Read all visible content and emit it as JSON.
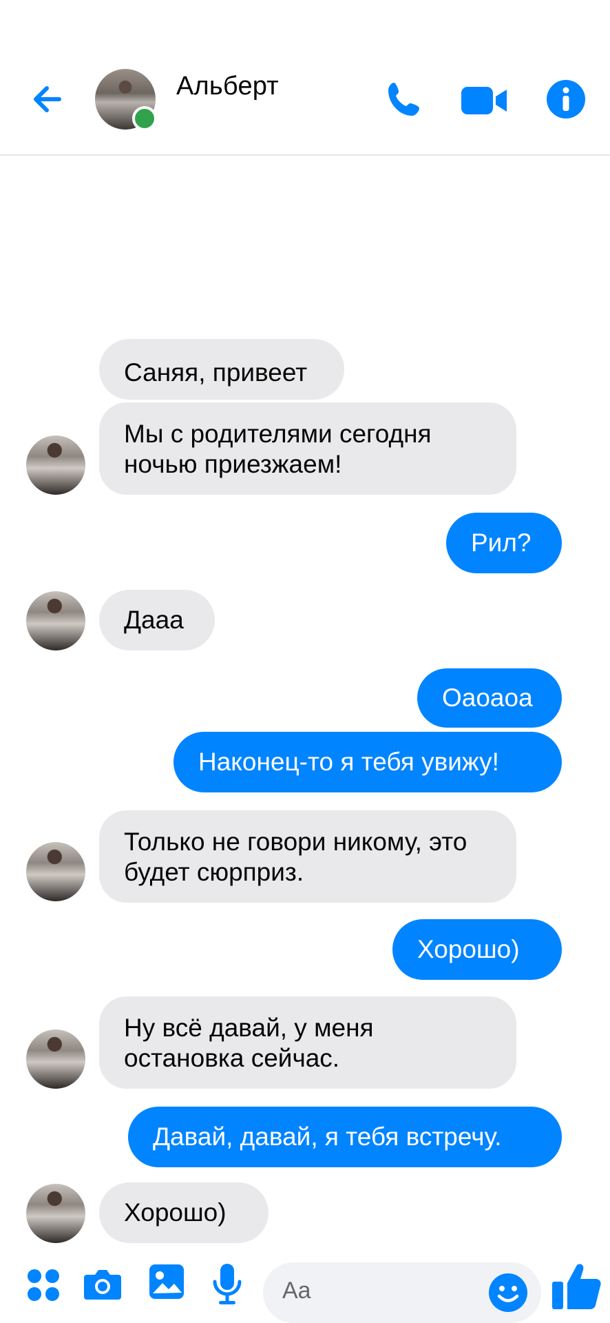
{
  "header": {
    "contact_name": "Альберт",
    "online": true
  },
  "messages": [
    {
      "dir": "in",
      "text": "Саняя, привеет"
    },
    {
      "dir": "in",
      "text": "Мы с родителями сегодня ночью приезжаем!"
    },
    {
      "dir": "out",
      "text": "Рил?"
    },
    {
      "dir": "in",
      "text": "Дааа"
    },
    {
      "dir": "out",
      "text": "Оаоаоа"
    },
    {
      "dir": "out",
      "text": "Наконец-то я тебя увижу!"
    },
    {
      "dir": "in",
      "text": "Только не говори никому, это будет сюрприз."
    },
    {
      "dir": "out",
      "text": "Хорошо)"
    },
    {
      "dir": "in",
      "text": "Ну всё давай, у меня остановка сейчас."
    },
    {
      "dir": "out",
      "text": "Давай, давай, я тебя встречу."
    },
    {
      "dir": "in",
      "text": "Хорошо)"
    }
  ],
  "composer": {
    "placeholder": "Aa"
  },
  "colors": {
    "accent": "#0084ff",
    "incoming_bubble": "#e9e9eb",
    "online": "#31a24c"
  },
  "icons": [
    "back-arrow-icon",
    "phone-icon",
    "video-camera-icon",
    "info-icon",
    "apps-icon",
    "camera-icon",
    "image-icon",
    "microphone-icon",
    "emoji-icon",
    "thumbs-up-icon"
  ]
}
